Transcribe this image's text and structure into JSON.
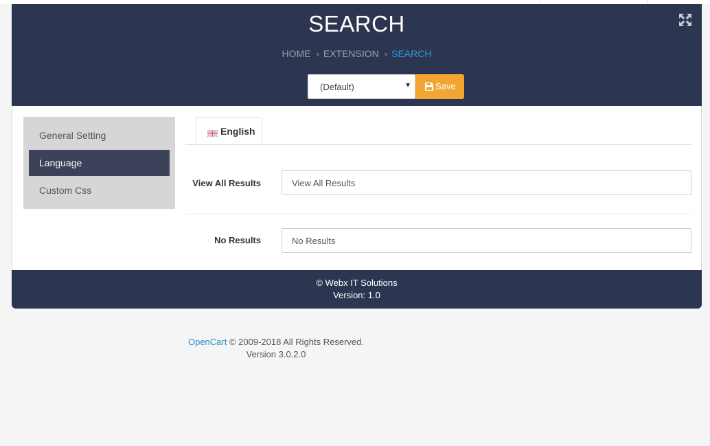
{
  "header": {
    "title": "SEARCH",
    "breadcrumb": [
      "HOME",
      "EXTENSION",
      "SEARCH"
    ],
    "breadcrumb_separator": "›",
    "store_select": {
      "selected": "(Default)"
    },
    "save_label": "Save",
    "expand_icon": "expand-arrows-icon"
  },
  "sidebar": {
    "items": [
      {
        "label": "General Setting",
        "active": false
      },
      {
        "label": "Language",
        "active": true
      },
      {
        "label": "Custom Css",
        "active": false
      }
    ]
  },
  "tabs": [
    {
      "label": "English",
      "icon": "uk-flag-icon",
      "active": true
    }
  ],
  "form": {
    "view_all_results": {
      "label": "View All Results",
      "value": "View All Results"
    },
    "no_results": {
      "label": "No Results",
      "value": "No Results"
    }
  },
  "panel_footer": {
    "line1": "© Webx IT Solutions",
    "line2": "Version: 1.0"
  },
  "page_footer": {
    "link": "OpenCart",
    "copyright": "© 2009-2018 All Rights Reserved.",
    "version": "Version 3.0.2.0"
  },
  "colors": {
    "header_bg": "#2d3651",
    "active_breadcrumb": "#2c9cdb",
    "save_button": "#f2a531",
    "sidebar_bg": "#d6d6d6",
    "sidebar_active": "#3b4259"
  }
}
